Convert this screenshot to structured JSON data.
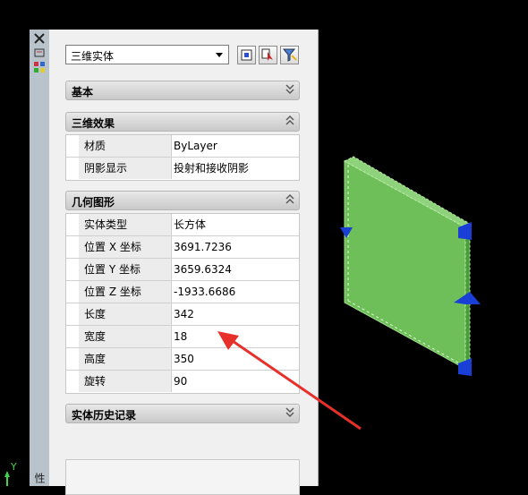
{
  "palette": {
    "vertical_title": "特性",
    "selected_object": "三维实体"
  },
  "sections": [
    {
      "title": "基本",
      "collapsed": true,
      "rows": []
    },
    {
      "title": "三维效果",
      "collapsed": false,
      "rows": [
        {
          "label": "材质",
          "value": "ByLayer"
        },
        {
          "label": "阴影显示",
          "value": "投射和接收阴影"
        }
      ]
    },
    {
      "title": "几何图形",
      "collapsed": false,
      "rows": [
        {
          "label": "实体类型",
          "value": "长方体"
        },
        {
          "label": "位置 X 坐标",
          "value": "3691.7236"
        },
        {
          "label": "位置 Y 坐标",
          "value": "3659.6324"
        },
        {
          "label": "位置 Z 坐标",
          "value": "-1933.6686"
        },
        {
          "label": "长度",
          "value": "342"
        },
        {
          "label": "宽度",
          "value": "18"
        },
        {
          "label": "高度",
          "value": "350"
        },
        {
          "label": "旋转",
          "value": "90"
        }
      ]
    },
    {
      "title": "实体历史记录",
      "collapsed": true,
      "rows": []
    }
  ],
  "ucs": {
    "y_label": "Y"
  },
  "colors": {
    "box_face": "#6ebf5a",
    "grip": "#1a3fd6",
    "annotation_arrow": "#e8302a"
  }
}
